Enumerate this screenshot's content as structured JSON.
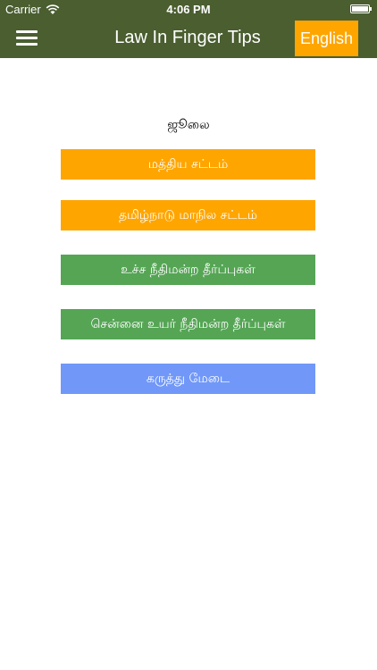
{
  "status_bar": {
    "carrier": "Carrier",
    "time": "4:06 PM",
    "wifi_icon": "wifi-icon",
    "battery_icon": "battery-full-icon",
    "battery_level": 1.0
  },
  "nav": {
    "menu_icon": "hamburger-menu-icon",
    "title": "Law In Finger Tips",
    "language_button": "English"
  },
  "content": {
    "month": "ஜூலை",
    "buttons": [
      {
        "label": "மத்திய  சட்டம்",
        "color": "#ffa500"
      },
      {
        "label": "தமிழ்நாடு மாநில சட்டம்",
        "color": "#ffa500"
      },
      {
        "label": "உச்ச நீதிமன்ற தீர்ப்புகள்",
        "color": "#55a555"
      },
      {
        "label": "சென்னை உயர் நீதிமன்ற தீர்ப்புகள்",
        "color": "#55a555"
      },
      {
        "label": "கருத்து மேடை",
        "color": "#7198f8"
      }
    ]
  },
  "colors": {
    "header": "#4a5e30",
    "accent_orange": "#ffa500",
    "accent_green": "#55a555",
    "accent_blue": "#7198f8"
  }
}
